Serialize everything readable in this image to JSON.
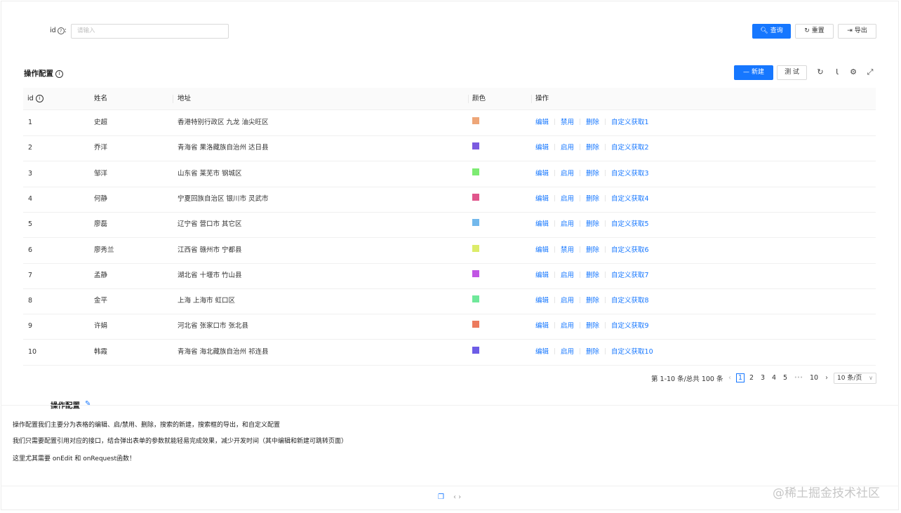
{
  "search": {
    "id_label": "id",
    "id_colon": ":",
    "help_icon": "?",
    "placeholder": "请输入",
    "query_label": "查询",
    "reset_label": "重置",
    "export_label": "导出"
  },
  "table": {
    "title": "操作配置",
    "info_icon": "i",
    "new_label": "新建",
    "test_label": "测 试",
    "columns": {
      "id": "id",
      "name": "姓名",
      "address": "地址",
      "color": "颜色",
      "actions": "操作"
    },
    "rows": [
      {
        "id": "1",
        "name": "史超",
        "address": "香港特别行政区 九龙 油尖旺区",
        "color": "#eea678",
        "a1": "编辑",
        "a2": "禁用",
        "a3": "删除",
        "a4": "自定义获取1"
      },
      {
        "id": "2",
        "name": "乔洋",
        "address": "青海省 果洛藏族自治州 达日县",
        "color": "#7b5be0",
        "a1": "编辑",
        "a2": "启用",
        "a3": "删除",
        "a4": "自定义获取2"
      },
      {
        "id": "3",
        "name": "邹洋",
        "address": "山东省 莱芜市 钢城区",
        "color": "#7deb72",
        "a1": "编辑",
        "a2": "启用",
        "a3": "删除",
        "a4": "自定义获取3"
      },
      {
        "id": "4",
        "name": "何静",
        "address": "宁夏回族自治区 银川市 灵武市",
        "color": "#e0568c",
        "a1": "编辑",
        "a2": "启用",
        "a3": "删除",
        "a4": "自定义获取4"
      },
      {
        "id": "5",
        "name": "廖磊",
        "address": "辽宁省 营口市 其它区",
        "color": "#72b8ec",
        "a1": "编辑",
        "a2": "启用",
        "a3": "删除",
        "a4": "自定义获取5"
      },
      {
        "id": "6",
        "name": "廖秀兰",
        "address": "江西省 赣州市 宁都县",
        "color": "#dcec6a",
        "a1": "编辑",
        "a2": "禁用",
        "a3": "删除",
        "a4": "自定义获取6"
      },
      {
        "id": "7",
        "name": "孟静",
        "address": "湖北省 十堰市 竹山县",
        "color": "#c156e4",
        "a1": "编辑",
        "a2": "启用",
        "a3": "删除",
        "a4": "自定义获取7"
      },
      {
        "id": "8",
        "name": "金平",
        "address": "上海 上海市 虹口区",
        "color": "#6fe89a",
        "a1": "编辑",
        "a2": "启用",
        "a3": "删除",
        "a4": "自定义获取8"
      },
      {
        "id": "9",
        "name": "许娟",
        "address": "河北省 张家口市 张北县",
        "color": "#ec7b5e",
        "a1": "编辑",
        "a2": "启用",
        "a3": "删除",
        "a4": "自定义获取9"
      },
      {
        "id": "10",
        "name": "韩霞",
        "address": "青海省 海北藏族自治州 祁连县",
        "color": "#6d5ce6",
        "a1": "编辑",
        "a2": "启用",
        "a3": "删除",
        "a4": "自定义获取10"
      }
    ]
  },
  "pagination": {
    "total_text": "第 1-10 条/总共 100 条",
    "pages": [
      "1",
      "2",
      "3",
      "4",
      "5",
      "10"
    ],
    "ellipsis": "•••",
    "page_size": "10 条/页"
  },
  "doc": {
    "title": "操作配置",
    "p1": "操作配置我们主要分为表格的编辑、启/禁用、删除，搜索的新建，搜索框的导出，和自定义配置",
    "p2": "我们只需要配置引用对应的接口，结合弹出表单的参数就能轻易完成效果，减少开发时间（其中编辑和新建可跳转页面）",
    "p3": "这里尤其需要 onEdit 和 onRequest函数！"
  },
  "watermark": "@稀土掘金技术社区",
  "colors": {
    "primary": "#1677ff"
  }
}
